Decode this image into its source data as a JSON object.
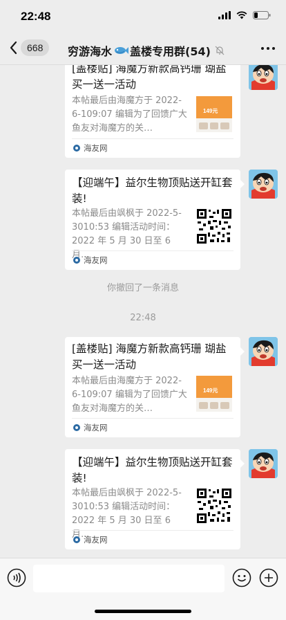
{
  "status": {
    "time": "22:48"
  },
  "header": {
    "back_count": "668",
    "title_part1": "穷游海水",
    "title_part2": "盖楼专用群(54)"
  },
  "messages": [
    {
      "title": "[盖楼贴] 海魔方新款高钙珊 瑚盐买一送一活动",
      "desc": "本帖最后由海魔方于 2022-6-109:07 编辑为了回馈广大鱼友对海魔方的关…",
      "source": "海友网",
      "thumb": "promo",
      "thumb_text": "149元"
    },
    {
      "title": "【迎端午】益尔生物顶贴送开缸套装!",
      "desc": "本帖最后由飒枫于 2022-5-3010:53 编辑活动时间：2022 年 5 月 30 日至 6 月…",
      "source": "海友网",
      "thumb": "qr"
    },
    {
      "title": "[盖楼贴] 海魔方新款高钙珊 瑚盐买一送一活动",
      "desc": "本帖最后由海魔方于 2022-6-109:07 编辑为了回馈广大鱼友对海魔方的关…",
      "source": "海友网",
      "thumb": "promo",
      "thumb_text": "149元"
    },
    {
      "title": "【迎端午】益尔生物顶贴送开缸套装!",
      "desc": "本帖最后由飒枫于 2022-5-3010:53 编辑活动时间：2022 年 5 月 30 日至 6 月…",
      "source": "海友网",
      "thumb": "qr"
    }
  ],
  "system": {
    "recall_notice": "你撤回了一条消息",
    "timestamp": "22:48"
  },
  "colors": {
    "background": "#ededed",
    "card": "#ffffff",
    "muted_text": "#8a8a8a",
    "promo_orange": "#f39a3c"
  }
}
